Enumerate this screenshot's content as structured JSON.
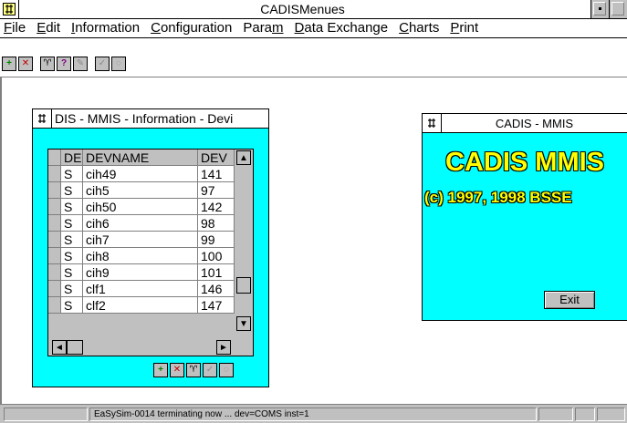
{
  "app": {
    "title": "CADISMenues"
  },
  "menu": [
    {
      "label": "File",
      "u": "F",
      "rest": "ile"
    },
    {
      "label": "Edit",
      "u": "E",
      "rest": "dit"
    },
    {
      "label": "Information",
      "u": "I",
      "rest": "nformation"
    },
    {
      "label": "Configuration",
      "u": "C",
      "rest": "onfiguration"
    },
    {
      "label": "Param",
      "pre": "Para",
      "u": "m",
      "rest": ""
    },
    {
      "label": "Data Exchange",
      "u": "D",
      "rest": "ata Exchange"
    },
    {
      "label": "Charts",
      "u": "C",
      "rest": "harts"
    },
    {
      "label": "Print",
      "u": "P",
      "rest": "rint"
    }
  ],
  "info_window": {
    "title": "DIS - MMIS - Information - Devi",
    "columns": [
      "DE",
      "DEVNAME",
      "DEV"
    ],
    "rows": [
      [
        "S",
        "cih49",
        "141"
      ],
      [
        "S",
        "cih5",
        "97"
      ],
      [
        "S",
        "cih50",
        "142"
      ],
      [
        "S",
        "cih6",
        "98"
      ],
      [
        "S",
        "cih7",
        "99"
      ],
      [
        "S",
        "cih8",
        "100"
      ],
      [
        "S",
        "cih9",
        "101"
      ],
      [
        "S",
        "clf1",
        "146"
      ],
      [
        "S",
        "clf2",
        "147"
      ]
    ]
  },
  "about_window": {
    "title": "CADIS - MMIS",
    "heading": "CADIS MMIS",
    "copyright": "(c) 1997, 1998 BSSE",
    "exit_label": "Exit"
  },
  "status": {
    "message": "EaSySim-0014 terminating now ... dev=COMS inst=1"
  },
  "colors": {
    "window_bg": "#00ffff",
    "heading_text": "#ffff00",
    "chrome": "#c0c0c0"
  }
}
